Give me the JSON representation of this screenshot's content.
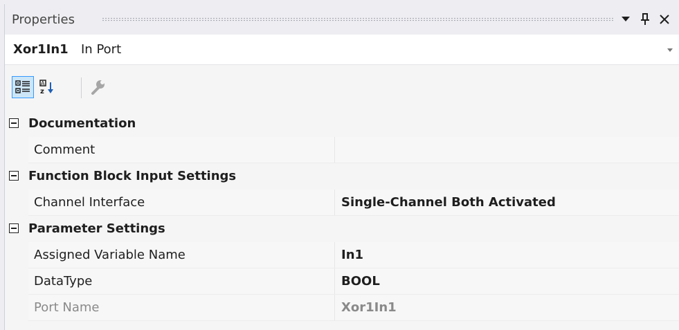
{
  "window": {
    "title": "Properties"
  },
  "selector": {
    "object_name": "Xor1In1",
    "object_type": "In Port"
  },
  "toolbar": {
    "buttons": [
      {
        "icon": "categorized-icon",
        "active": true
      },
      {
        "icon": "alphabetical-icon",
        "active": false
      },
      {
        "icon": "property-pages-icon",
        "active": false
      }
    ]
  },
  "categories": [
    {
      "label": "Documentation",
      "expanded": true,
      "properties": [
        {
          "name": "Comment",
          "value": ""
        }
      ]
    },
    {
      "label": "Function Block Input Settings",
      "expanded": true,
      "properties": [
        {
          "name": "Channel Interface",
          "value": "Single-Channel Both Activated"
        }
      ]
    },
    {
      "label": "Parameter Settings",
      "expanded": true,
      "properties": [
        {
          "name": "Assigned Variable Name",
          "value": "In1"
        },
        {
          "name": "DataType",
          "value": "BOOL"
        },
        {
          "name": "Port Name",
          "value": "Xor1In1",
          "readonly": true
        }
      ]
    }
  ],
  "colors": {
    "background": "#f5f5f5",
    "selection_border": "#3399ff",
    "selection_fill": "#cde6f7",
    "readonly_text": "#8a8a8a"
  }
}
